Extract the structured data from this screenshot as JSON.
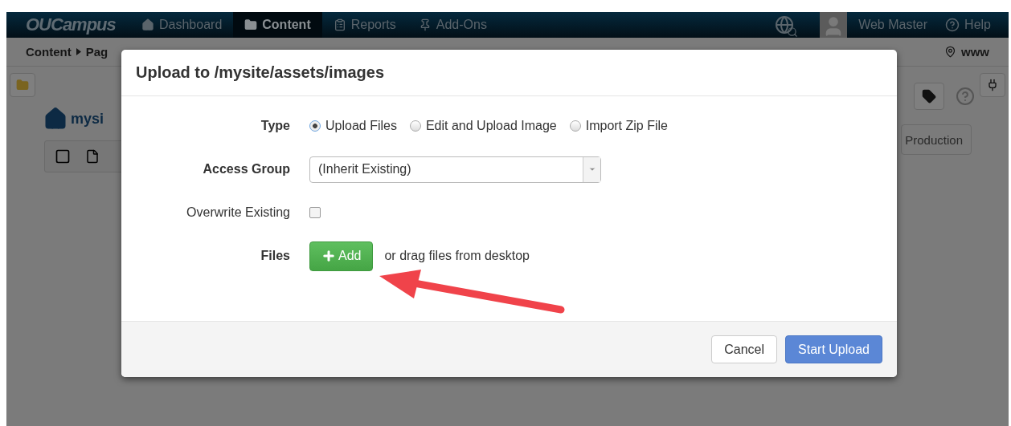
{
  "navbar": {
    "logo": "OUCampus",
    "items": [
      {
        "label": "Dashboard",
        "selected": false
      },
      {
        "label": "Content",
        "selected": true
      },
      {
        "label": "Reports",
        "selected": false
      },
      {
        "label": "Add-Ons",
        "selected": false
      }
    ],
    "user": "Web Master",
    "help": "Help"
  },
  "breadcrumb": {
    "items": [
      "Content",
      "Pag"
    ],
    "site": "www"
  },
  "path": {
    "label": "mysi"
  },
  "toolbar": {
    "production": "Production"
  },
  "dialog": {
    "title": "Upload to /mysite/assets/images",
    "type": {
      "label": "Type",
      "options": [
        {
          "label": "Upload Files",
          "selected": true
        },
        {
          "label": "Edit and Upload Image",
          "selected": false
        },
        {
          "label": "Import Zip File",
          "selected": false
        }
      ]
    },
    "access_group": {
      "label": "Access Group",
      "value": "(Inherit Existing)"
    },
    "overwrite": {
      "label": "Overwrite Existing",
      "checked": false
    },
    "files": {
      "label": "Files",
      "add": "Add",
      "hint": "or drag files from desktop"
    },
    "buttons": [
      {
        "label": "Cancel",
        "kind": "default"
      },
      {
        "label": "Start Upload",
        "kind": "primary"
      }
    ]
  }
}
